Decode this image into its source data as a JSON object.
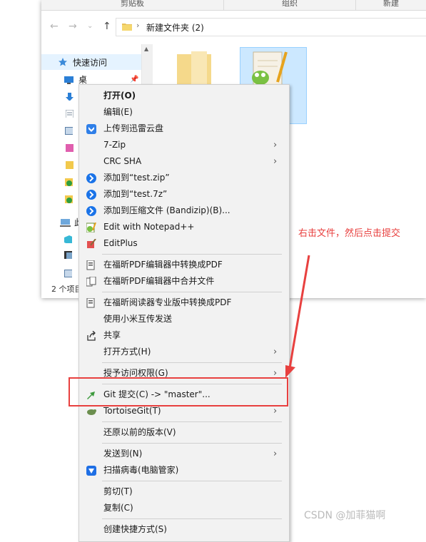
{
  "ribbon": {
    "groups": [
      "剪贴板",
      "组织",
      "新建"
    ]
  },
  "addressbar": {
    "path": "新建文件夹 (2)"
  },
  "navpane": {
    "quick_access": "快速访问",
    "desktop": "桌面",
    "this_pc_partial": "此"
  },
  "statusbar": {
    "items_partial": "2 个项目"
  },
  "context_menu": {
    "items": [
      {
        "label": "打开(O)"
      },
      {
        "label": "编辑(E)"
      },
      {
        "label": "上传到迅雷云盘"
      },
      {
        "label": "7-Zip"
      },
      {
        "label": "CRC SHA"
      },
      {
        "label": "添加到“test.zip”"
      },
      {
        "label": "添加到“test.7z”"
      },
      {
        "label": "添加到压缩文件 (Bandizip)(B)..."
      },
      {
        "label": "Edit with Notepad++"
      },
      {
        "label": "EditPlus"
      },
      {
        "label": "在福昕PDF编辑器中转换成PDF"
      },
      {
        "label": "在福昕PDF编辑器中合并文件"
      },
      {
        "label": "在福昕阅读器专业版中转换成PDF"
      },
      {
        "label": "使用小米互传发送"
      },
      {
        "label": "共享"
      },
      {
        "label": "打开方式(H)"
      },
      {
        "label": "授予访问权限(G)"
      },
      {
        "label": "Git 提交(C) -> \"master\"..."
      },
      {
        "label": "TortoiseGit(T)"
      },
      {
        "label": "还原以前的版本(V)"
      },
      {
        "label": "发送到(N)"
      },
      {
        "label": "扫描病毒(电脑管家)"
      },
      {
        "label": "剪切(T)"
      },
      {
        "label": "复制(C)"
      },
      {
        "label": "创建快捷方式(S)"
      }
    ]
  },
  "annotation": {
    "text": "右击文件，然后点击提交"
  },
  "watermark": "CSDN @加菲猫啊",
  "colors": {
    "accent_red": "#e8403f",
    "selection_blue": "#cce8ff",
    "menu_bg": "#f2f2f2"
  }
}
